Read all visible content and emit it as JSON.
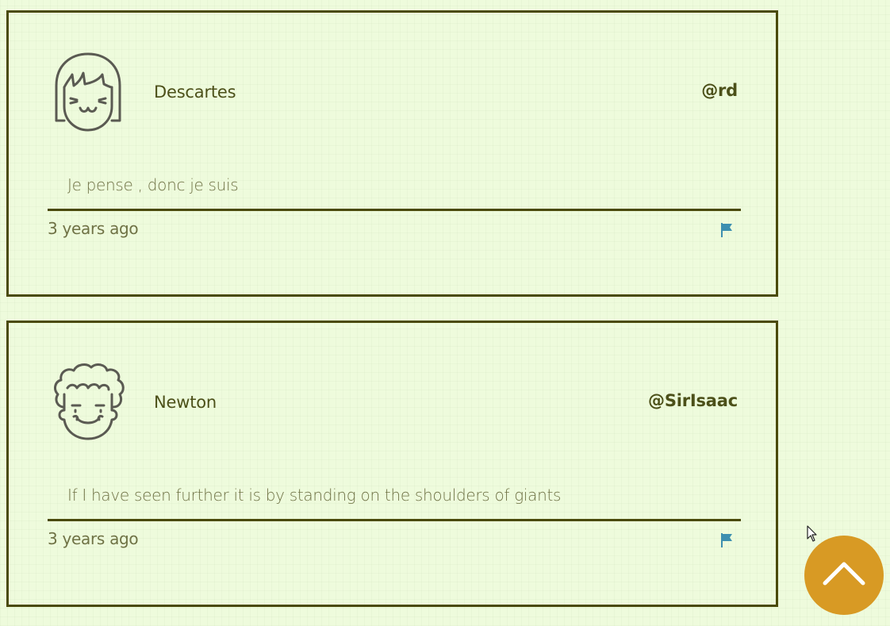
{
  "colors": {
    "background": "#eefbdc",
    "card_border": "#4a4a0a",
    "text": "#4c5019",
    "muted_text": "#6f7245",
    "flag": "#3d8fb0",
    "scroll_button": "#d89a24"
  },
  "comments": [
    {
      "name": "Descartes",
      "handle": "@rd",
      "quote": "Je pense , donc je suis",
      "time": "3 years ago",
      "avatar_icon": "girl-face-icon",
      "flag_icon": "flag-icon"
    },
    {
      "name": "Newton",
      "handle": "@SirIsaac",
      "quote": "If I have seen further it is by standing on the shoulders of giants",
      "time": "3 years ago",
      "avatar_icon": "curly-hair-face-icon",
      "flag_icon": "flag-icon"
    }
  ],
  "scroll_top": {
    "icon": "chevron-up-icon"
  }
}
